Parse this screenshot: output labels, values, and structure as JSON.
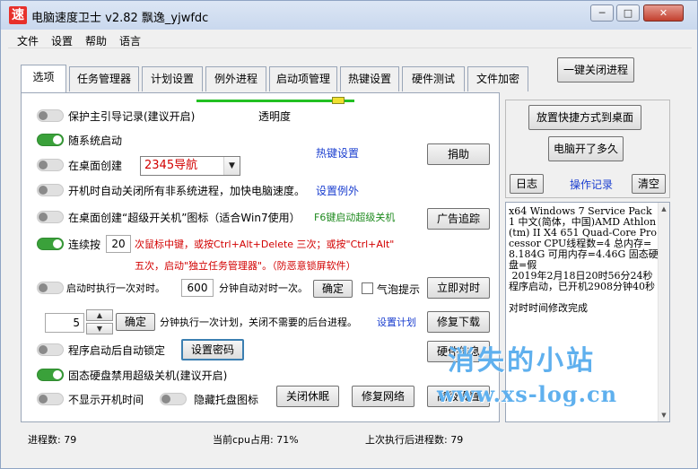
{
  "window": {
    "icon_char": "速",
    "title": "电脑速度卫士 v2.82  飘逸_yjwfdc",
    "minimize": "─",
    "maximize": "□",
    "close": "✕"
  },
  "menu": [
    "文件",
    "设置",
    "帮助",
    "语言"
  ],
  "tabs": [
    {
      "label": "选项",
      "active": true
    },
    {
      "label": "任务管理器"
    },
    {
      "label": "计划设置"
    },
    {
      "label": "例外进程"
    },
    {
      "label": "启动项管理"
    },
    {
      "label": "热键设置"
    },
    {
      "label": "硬件测试"
    },
    {
      "label": "文件加密"
    }
  ],
  "one_click_close": "一键关闭进程",
  "opacity_label": "透明度",
  "opacity_value": 0.9,
  "options": {
    "protect_boot": "保护主引导记录(建议开启)",
    "run_on_startup": "随系统启动",
    "desktop_create": "在桌面创建",
    "desktop_select_value": "2345导航",
    "hotkey_settings": "热键设置",
    "donate": "捐助",
    "auto_close_nonsystem": "开机时自动关闭所有非系统进程，加快电脑速度。",
    "set_exception": "设置例外",
    "create_superswitch": "在桌面创建“超级开关机”图标（适合Win7使用）",
    "f6_super_shutdown": "F6键启动超级关机",
    "ad_tracking": "广告追踪",
    "consecutive_press": "连续按",
    "press_count": "20",
    "press_desc_line1": "次鼠标中键，或按Ctrl+Alt+Delete 三次；或按\"Ctrl+Alt\"",
    "press_desc_line2": "五次，启动\"独立任务管理器\"。（防恶意锁屏软件）",
    "sync_time_startup": "启动时执行一次对时。",
    "sync_minutes": "600",
    "auto_sync_minutes": "分钟自动对时一次。",
    "confirm": "确定",
    "bubble_tip": "气泡提示",
    "sync_now": "立即对时",
    "plan_minutes": "5",
    "plan_desc": "分钟执行一次计划，关闭不需要的后台进程。",
    "set_plan": "设置计划",
    "repair_download": "修复下载",
    "auto_lock": "程序启动后自动锁定",
    "set_password": "设置密码",
    "hardware_info": "硬件信息",
    "ssd_disable_super_shutdown": "固态硬盘禁用超级关机(建议开启)",
    "hide_boot_time": "不显示开机时间",
    "hide_tray_icon": "隐藏托盘图标",
    "close_sleep": "关闭休眠",
    "repair_network": "修复网络",
    "advanced_settings": "高级设置"
  },
  "toggles": {
    "protect_boot": false,
    "run_on_startup": true,
    "desktop_create": false,
    "auto_close_nonsystem": false,
    "create_superswitch": false,
    "consecutive_press": true,
    "sync_time_startup": false,
    "auto_lock": false,
    "ssd_disable_super_shutdown": true,
    "hide_boot_time": false,
    "hide_tray_icon": false
  },
  "right": {
    "place_shortcut": "放置快捷方式到桌面",
    "uptime": "电脑开了多久",
    "log": "日志",
    "operation_log": "操作记录",
    "clear": "清空",
    "log_text": "x64 Windows 7 Service Pack 1 中文(简体，中国)AMD Athlon(tm) II X4 651 Quad-Core Processor CPU线程数=4 总内存=8.184G 可用内存=4.46G 固态硬盘=假\n 2019年2月18日20时56分24秒 程序启动，已开机2908分钟40秒\n\n对时时间修改完成"
  },
  "watermark": {
    "line1": "消失的小站",
    "line2": "www.xs-log.cn"
  },
  "status": {
    "processes": "进程数: 79",
    "cpu": "当前cpu占用: 71%",
    "last_processes": "上次执行后进程数: 79"
  },
  "colors": {
    "accent_green": "#3aa13a",
    "link_blue": "#1a3ecf",
    "warning_red": "#d20000",
    "watermark_blue": "#5fb0ee"
  }
}
